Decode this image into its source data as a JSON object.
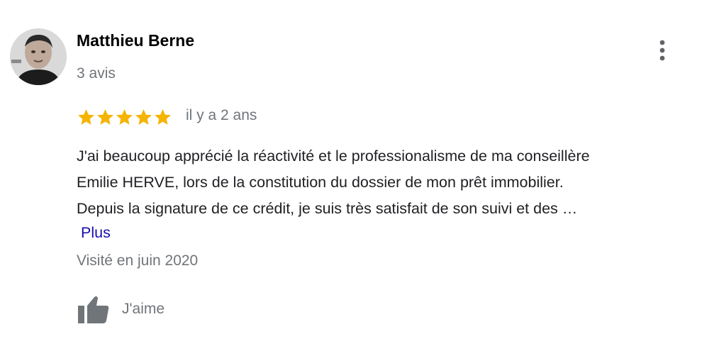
{
  "review": {
    "author": {
      "name": "Matthieu Berne",
      "review_count": "3 avis",
      "avatar_icon": "user-photo"
    },
    "menu_icon": "more-vert-icon",
    "rating": 5,
    "rating_max": 5,
    "star_color": "#f4b400",
    "date": "il y a 2 ans",
    "text_lines": [
      "J'ai beaucoup apprécié la réactivité et le professionalisme de ma conseillère",
      "Emilie HERVE, lors de la constitution du dossier de mon prêt immobilier.",
      "Depuis la signature de ce crédit, je suis très satisfait de son suivi et des …"
    ],
    "more_label": "Plus",
    "visited": "Visité en juin 2020",
    "like_icon": "thumbs-up-icon",
    "like_label": "J'aime",
    "link_color": "#1a0dab",
    "muted_color": "#70757a"
  }
}
